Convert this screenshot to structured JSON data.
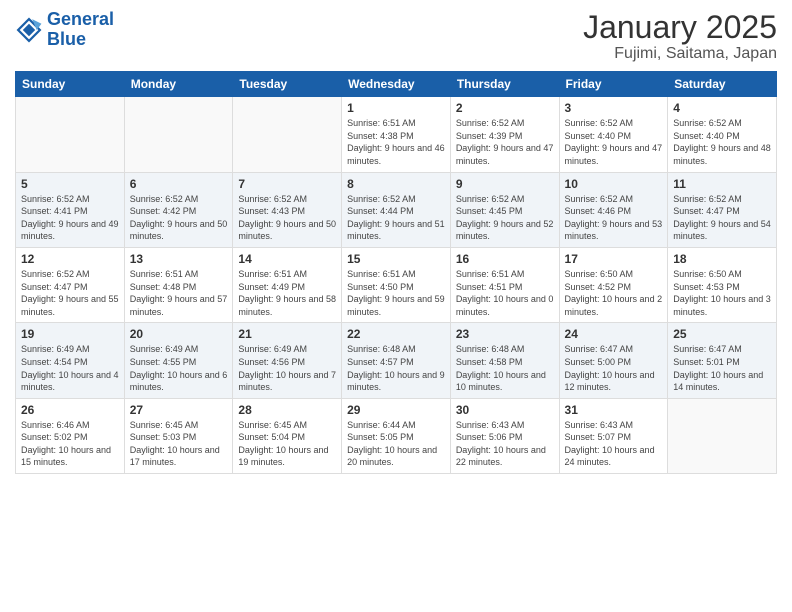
{
  "header": {
    "logo_line1": "General",
    "logo_line2": "Blue",
    "title": "January 2025",
    "subtitle": "Fujimi, Saitama, Japan"
  },
  "weekdays": [
    "Sunday",
    "Monday",
    "Tuesday",
    "Wednesday",
    "Thursday",
    "Friday",
    "Saturday"
  ],
  "weeks": [
    [
      {
        "day": "",
        "info": ""
      },
      {
        "day": "",
        "info": ""
      },
      {
        "day": "",
        "info": ""
      },
      {
        "day": "1",
        "info": "Sunrise: 6:51 AM\nSunset: 4:38 PM\nDaylight: 9 hours\nand 46 minutes."
      },
      {
        "day": "2",
        "info": "Sunrise: 6:52 AM\nSunset: 4:39 PM\nDaylight: 9 hours\nand 47 minutes."
      },
      {
        "day": "3",
        "info": "Sunrise: 6:52 AM\nSunset: 4:40 PM\nDaylight: 9 hours\nand 47 minutes."
      },
      {
        "day": "4",
        "info": "Sunrise: 6:52 AM\nSunset: 4:40 PM\nDaylight: 9 hours\nand 48 minutes."
      }
    ],
    [
      {
        "day": "5",
        "info": "Sunrise: 6:52 AM\nSunset: 4:41 PM\nDaylight: 9 hours\nand 49 minutes."
      },
      {
        "day": "6",
        "info": "Sunrise: 6:52 AM\nSunset: 4:42 PM\nDaylight: 9 hours\nand 50 minutes."
      },
      {
        "day": "7",
        "info": "Sunrise: 6:52 AM\nSunset: 4:43 PM\nDaylight: 9 hours\nand 50 minutes."
      },
      {
        "day": "8",
        "info": "Sunrise: 6:52 AM\nSunset: 4:44 PM\nDaylight: 9 hours\nand 51 minutes."
      },
      {
        "day": "9",
        "info": "Sunrise: 6:52 AM\nSunset: 4:45 PM\nDaylight: 9 hours\nand 52 minutes."
      },
      {
        "day": "10",
        "info": "Sunrise: 6:52 AM\nSunset: 4:46 PM\nDaylight: 9 hours\nand 53 minutes."
      },
      {
        "day": "11",
        "info": "Sunrise: 6:52 AM\nSunset: 4:47 PM\nDaylight: 9 hours\nand 54 minutes."
      }
    ],
    [
      {
        "day": "12",
        "info": "Sunrise: 6:52 AM\nSunset: 4:47 PM\nDaylight: 9 hours\nand 55 minutes."
      },
      {
        "day": "13",
        "info": "Sunrise: 6:51 AM\nSunset: 4:48 PM\nDaylight: 9 hours\nand 57 minutes."
      },
      {
        "day": "14",
        "info": "Sunrise: 6:51 AM\nSunset: 4:49 PM\nDaylight: 9 hours\nand 58 minutes."
      },
      {
        "day": "15",
        "info": "Sunrise: 6:51 AM\nSunset: 4:50 PM\nDaylight: 9 hours\nand 59 minutes."
      },
      {
        "day": "16",
        "info": "Sunrise: 6:51 AM\nSunset: 4:51 PM\nDaylight: 10 hours\nand 0 minutes."
      },
      {
        "day": "17",
        "info": "Sunrise: 6:50 AM\nSunset: 4:52 PM\nDaylight: 10 hours\nand 2 minutes."
      },
      {
        "day": "18",
        "info": "Sunrise: 6:50 AM\nSunset: 4:53 PM\nDaylight: 10 hours\nand 3 minutes."
      }
    ],
    [
      {
        "day": "19",
        "info": "Sunrise: 6:49 AM\nSunset: 4:54 PM\nDaylight: 10 hours\nand 4 minutes."
      },
      {
        "day": "20",
        "info": "Sunrise: 6:49 AM\nSunset: 4:55 PM\nDaylight: 10 hours\nand 6 minutes."
      },
      {
        "day": "21",
        "info": "Sunrise: 6:49 AM\nSunset: 4:56 PM\nDaylight: 10 hours\nand 7 minutes."
      },
      {
        "day": "22",
        "info": "Sunrise: 6:48 AM\nSunset: 4:57 PM\nDaylight: 10 hours\nand 9 minutes."
      },
      {
        "day": "23",
        "info": "Sunrise: 6:48 AM\nSunset: 4:58 PM\nDaylight: 10 hours\nand 10 minutes."
      },
      {
        "day": "24",
        "info": "Sunrise: 6:47 AM\nSunset: 5:00 PM\nDaylight: 10 hours\nand 12 minutes."
      },
      {
        "day": "25",
        "info": "Sunrise: 6:47 AM\nSunset: 5:01 PM\nDaylight: 10 hours\nand 14 minutes."
      }
    ],
    [
      {
        "day": "26",
        "info": "Sunrise: 6:46 AM\nSunset: 5:02 PM\nDaylight: 10 hours\nand 15 minutes."
      },
      {
        "day": "27",
        "info": "Sunrise: 6:45 AM\nSunset: 5:03 PM\nDaylight: 10 hours\nand 17 minutes."
      },
      {
        "day": "28",
        "info": "Sunrise: 6:45 AM\nSunset: 5:04 PM\nDaylight: 10 hours\nand 19 minutes."
      },
      {
        "day": "29",
        "info": "Sunrise: 6:44 AM\nSunset: 5:05 PM\nDaylight: 10 hours\nand 20 minutes."
      },
      {
        "day": "30",
        "info": "Sunrise: 6:43 AM\nSunset: 5:06 PM\nDaylight: 10 hours\nand 22 minutes."
      },
      {
        "day": "31",
        "info": "Sunrise: 6:43 AM\nSunset: 5:07 PM\nDaylight: 10 hours\nand 24 minutes."
      },
      {
        "day": "",
        "info": ""
      }
    ]
  ]
}
